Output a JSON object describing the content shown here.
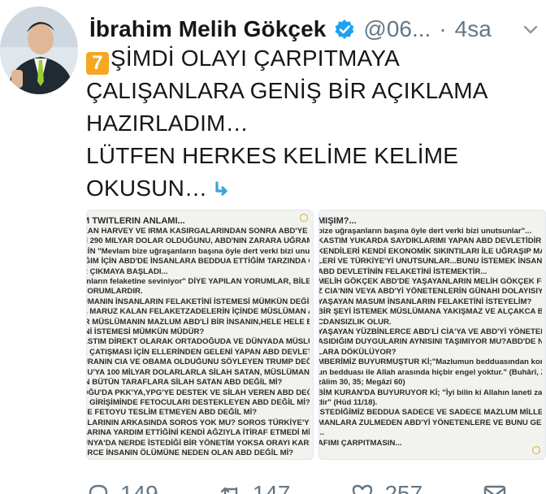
{
  "header": {
    "name": "İbrahim Melih Gökçek",
    "handle": "@06...",
    "separator": "·",
    "time": "4sa"
  },
  "tweet": {
    "emoji_number": "7",
    "text": "ŞİMDİ OLAYI ÇARPITMAYA ÇALIŞANLARA GENİŞ BİR AÇIKLAMA HAZIRLADIM…\nLÜTFEN HERKES KELİME KELİME OKUSUN…"
  },
  "media": {
    "left": {
      "lines": [
        "M TWITLERIN ANLAMI...",
        "KAN  HARVEY VE IRMA KASIRGALARINDAN SONRA ABD'YE ÇIKA",
        "N 290 MILYAR DOLAR OLDUĞUNU, ABD'NIN ZARARA UĞRAMASIN",
        "ÇİN \"Mevlam bize uğraşanların başına öyle dert verki bizi unutsun",
        "IĞIM İÇİN ABD'DE İNSANLARA BEDDUA ETTİĞİM TARZINDA ÇARP",
        "R ÇIKMAYA BAŞLADI...",
        "anların felaketine seviniyor\" DİYE YAPILAN YORUMLAR, BİLEREK G",
        "YORUMLARDIR.",
        "ÜMANIN İNSANLARIN FELAKETİNİ İSTEMESİ MÜMKÜN DEĞİLDİR.",
        "A MARUZ KALAN FELAKETZADELERİN İÇİNDE MÜSLÜMAN ABD'Lİ",
        "IR MÜSLÜMANIN MAZLUM ABD'Lİ BİR İNSANIN,HELE HELE BİR MÜSLÜMA",
        "İNİ İSTEMESİ MÜMKÜN MÜDÜR?",
        "ASTIM DİREKT OLARAK ORTADOĞUDA VE DÜNYADA MÜSLÜMANL",
        "E ÇATIŞMASI İÇİN ELLERİNDEN GELENİ YAPAN ABD DEVLETİDİR.",
        "URANIN CIA VE OBAMA OLDUĞUNU SÖYLEYEN TRUMP DEĞİL Mİ?",
        "SU'YA 100 MİLYAR DOLARLARLA SİLAH SATAN, MÜSLÜMANIN MÜ",
        "IN BÜTÜN TARAFLARA SİLAH SATAN ABD DEĞİL Mİ?",
        "OĞU'DA PKK'YA,YPG'YE DESTEK VE SİLAH VEREN ABD DEĞİL Mİ?",
        "E GİRİŞİMİNDE FETOCULARI DESTEKLEYEN ABD DEĞİL Mİ?",
        "YE FETOYU TESLİM ETMEYEN ABD DEĞİL Mİ?",
        "YLARININ ARKASINDA SOROS YOK MU? SOROS TÜRKİYE'YE GELD",
        "LARINA YARDIM ETTİĞİNİ KENDİ AĞZIYLA İTİRAF ETMEDİ Mİ?",
        "ÜNYA'DA NERDE İSTEDİĞİ BİR YÖNETİM YOKSA ORAYI KARIŞTIRA",
        "ERCE İNSANIN ÖLÜMÜNE NEDEN OLAN ABD DEĞİL Mİ?",
        "IŞIM?..."
      ]
    },
    "right": {
      "lines": [
        "MIŞIM?...",
        "bize uğraşanların başına öyle dert verki bizi unutsunlar\"...",
        "KASTIM YUKARDA SAYDIKLARIMI YAPAN ABD DEVLETİDİR.",
        "KENDİLERİ KENDİ EKONOMİK SIKINTILARI İLE UĞRAŞIP MAZLUM",
        "LERİ VE TÜRKİYE'Yİ UNUTSUNLAR...BUNU İSTEMEK İNSANLARIN FELA",
        "ABD DEVLETİNİN FELAKETİNİ İSTEMEKTİR...",
        "MELİH GÖKÇEK ABD'DE YAŞAYANLARIN MELİH GÖKÇEK FELAKETİNİ İS",
        "Z CIA'NIN VEYA ABD'Yİ YÖNETENLERİN GÜNAHI DOLAYISIYLA BİZ NİÇ",
        "YAŞAYAN MASUM İNSANLARIN FELAKETİNİ İSTEYELİM?",
        "BİR ŞEYİ İSTEMEK MÜSLÜMANA YAKIŞMAZ VE ALÇAKCA BİR YAKLAŞ",
        "CDANSIZLIK OLUR.",
        "YAŞAYAN YÜZBİNLERCE ABD'Lİ CİA'YA VE ABD'Yİ YÖNETENLERE KAR",
        "ASIDIĞIM DUYGULARIN AYNISINI TAŞIMIYOR MU?ABD'DE NİYE İNSAN",
        "LARA DÖKÜLÜYOR?",
        "MBERİMİZ BUYURMUŞTUR Kİ;\"Mazlumun bedduasından kork. Çünkü",
        "un bedduası ile Allah arasında hiçbir engel yoktur.\" (Buhârî, Zekâk 63,",
        "zâlim 30, 35; Megâzî 60)",
        "BİM KURAN'DA BUYURUYOR Kİ; \"İyi bilin ki Allahın laneti zalimlerin",
        "dir\" (Hûd 11/18).",
        "İSTEDİĞİMİZ BEDDUA SADECE VE SADECE MAZLUM MİLLETLERE VE",
        "MANLARA ZULMEDEN ABD'Yİ YÖNETENLERE VE BUNU GERÇEKLEŞTİR",
        "...",
        "AFIMI ÇARPITMASIN..."
      ]
    }
  },
  "actions": {
    "reply_count": "149",
    "retweet_count": "147",
    "like_count": "257"
  },
  "colors": {
    "verified": "#1da1f2",
    "secondary_text": "#657786",
    "emoji_box": "#f5a623",
    "arrow_emoji": "#3aa3d9"
  }
}
